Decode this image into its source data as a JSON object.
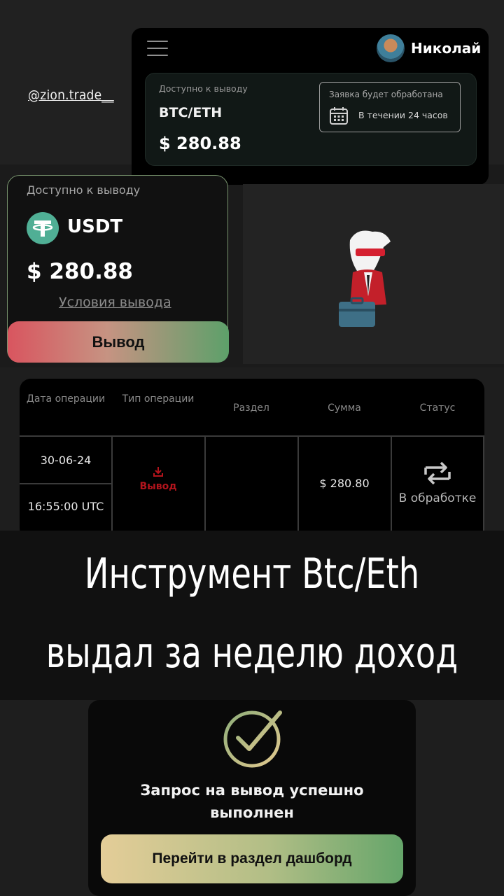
{
  "watermark": "@zion.trade__",
  "header": {
    "user_name": "Николай",
    "btc_panel": {
      "caption": "Доступно к выводу",
      "asset": "BTC/ETH",
      "amount": "$ 280.88",
      "notice_title": "Заявка будет обработана",
      "notice_time": "В течении 24 часов"
    }
  },
  "usdt_card": {
    "caption": "Доступно к выводу",
    "asset": "USDT",
    "amount": "$ 280.88",
    "terms_link": "Условия вывода",
    "withdraw_button": "Вывод"
  },
  "table": {
    "headers": [
      "Дата операции",
      "Тип операции",
      "Раздел",
      "Сумма",
      "Статус"
    ],
    "row": {
      "date": "30-06-24",
      "time": "16:55:00 UTC",
      "type": "Вывод",
      "section": "",
      "amount": "$ 280.80",
      "status": "В обработке"
    }
  },
  "hero": {
    "line1": "Инструмент Btc/Eth",
    "line2": "выдал за неделю доход"
  },
  "success": {
    "message": "Запрос на вывод успешно выполнен",
    "dashboard_button": "Перейти в раздел дашборд"
  },
  "colors": {
    "withdraw_red": "#b3141c",
    "tether_green": "#50af95",
    "accent_green": "#5da06a"
  },
  "icons": [
    "menu-icon",
    "avatar",
    "calendar-icon",
    "tether-icon",
    "download-icon",
    "sync-icon",
    "check-icon"
  ]
}
